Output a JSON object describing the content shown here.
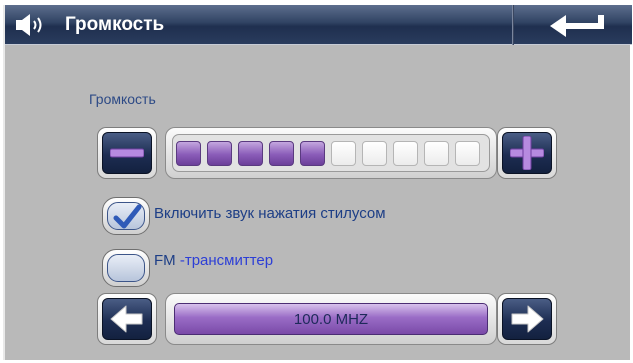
{
  "header": {
    "title": "Громкость"
  },
  "volume": {
    "label": "Громкость",
    "level": 5,
    "max": 10
  },
  "options": {
    "stylus_sound": {
      "label": "Включить звук нажатия стилусом",
      "checked": true
    },
    "fm": {
      "label_prefix": "FM",
      "label_suffix": " -трансмиттер",
      "checked": false
    }
  },
  "frequency": {
    "value": "100.0 MHZ"
  },
  "colors": {
    "title_bar": "#304363",
    "background": "#b9b9b9",
    "segment_on": "#8a5cb8",
    "label_text": "#2d4a86"
  },
  "icons": {
    "header": "speaker-icon",
    "back": "return-arrow-icon",
    "minus": "minus-icon",
    "plus": "plus-icon",
    "left": "arrow-left-icon",
    "right": "arrow-right-icon",
    "check": "checkmark-icon"
  }
}
